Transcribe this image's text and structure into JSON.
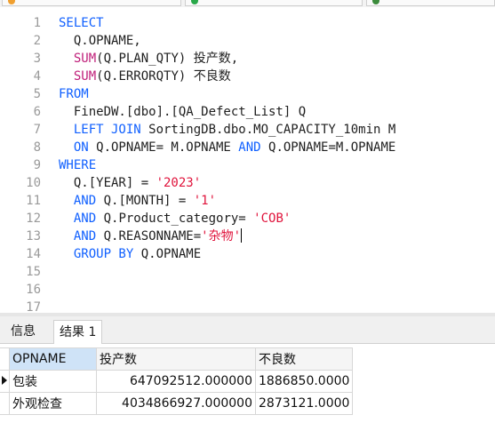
{
  "editor": {
    "lines": [
      {
        "n": "1",
        "tokens": [
          {
            "t": "SELECT",
            "c": "kw"
          }
        ]
      },
      {
        "n": "2",
        "tokens": [
          {
            "t": "  Q.OPNAME,",
            "c": ""
          }
        ]
      },
      {
        "n": "3",
        "tokens": [
          {
            "t": "  ",
            "c": ""
          },
          {
            "t": "SUM",
            "c": "fn"
          },
          {
            "t": "(Q.PLAN_QTY) 投产数,",
            "c": ""
          }
        ]
      },
      {
        "n": "4",
        "tokens": [
          {
            "t": "  ",
            "c": ""
          },
          {
            "t": "SUM",
            "c": "fn"
          },
          {
            "t": "(Q.ERRORQTY) 不良数",
            "c": ""
          }
        ]
      },
      {
        "n": "5",
        "tokens": [
          {
            "t": "FROM",
            "c": "kw"
          }
        ]
      },
      {
        "n": "6",
        "tokens": [
          {
            "t": "  FineDW.[dbo].[QA_Defect_List] Q",
            "c": ""
          }
        ]
      },
      {
        "n": "7",
        "tokens": [
          {
            "t": "  ",
            "c": ""
          },
          {
            "t": "LEFT JOIN",
            "c": "kw"
          },
          {
            "t": " SortingDB.dbo.MO_CAPACITY_10min M",
            "c": ""
          }
        ]
      },
      {
        "n": "8",
        "tokens": [
          {
            "t": "  ",
            "c": ""
          },
          {
            "t": "ON",
            "c": "kw"
          },
          {
            "t": " Q.OPNAME= M.OPNAME ",
            "c": ""
          },
          {
            "t": "AND",
            "c": "kw"
          },
          {
            "t": " Q.OPNAME=M.OPNAME",
            "c": ""
          }
        ]
      },
      {
        "n": "9",
        "tokens": [
          {
            "t": "WHERE",
            "c": "kw"
          }
        ]
      },
      {
        "n": "10",
        "tokens": [
          {
            "t": "  Q.[YEAR] = ",
            "c": ""
          },
          {
            "t": "'2023'",
            "c": "str"
          }
        ]
      },
      {
        "n": "11",
        "tokens": [
          {
            "t": "  ",
            "c": ""
          },
          {
            "t": "AND",
            "c": "kw"
          },
          {
            "t": " Q.[MONTH] = ",
            "c": ""
          },
          {
            "t": "'1'",
            "c": "str"
          }
        ]
      },
      {
        "n": "12",
        "tokens": [
          {
            "t": "  ",
            "c": ""
          },
          {
            "t": "AND",
            "c": "kw"
          },
          {
            "t": " Q.Product_category= ",
            "c": ""
          },
          {
            "t": "'COB'",
            "c": "str"
          }
        ]
      },
      {
        "n": "13",
        "tokens": [
          {
            "t": "  ",
            "c": ""
          },
          {
            "t": "AND",
            "c": "kw"
          },
          {
            "t": " Q.REASONNAME=",
            "c": ""
          },
          {
            "t": "'杂物'",
            "c": "str"
          }
        ],
        "caret": true
      },
      {
        "n": "14",
        "tokens": [
          {
            "t": "  ",
            "c": ""
          },
          {
            "t": "GROUP BY",
            "c": "kw"
          },
          {
            "t": " Q.OPNAME",
            "c": ""
          }
        ]
      },
      {
        "n": "15",
        "tokens": []
      },
      {
        "n": "16",
        "tokens": []
      },
      {
        "n": "17",
        "tokens": []
      }
    ]
  },
  "result_tabs": {
    "info": "信息",
    "result1": "结果 1"
  },
  "grid": {
    "columns": [
      "OPNAME",
      "投产数",
      "不良数"
    ],
    "rows": [
      [
        "包装",
        "647092512.000000",
        "1886850.0000"
      ],
      [
        "外观检查",
        "4034866927.000000",
        "2873121.0000"
      ]
    ]
  },
  "colors": {
    "keyword": "#1060ff",
    "function": "#c0207a",
    "string": "#e0143c",
    "selected_header": "#cfe3f7"
  }
}
